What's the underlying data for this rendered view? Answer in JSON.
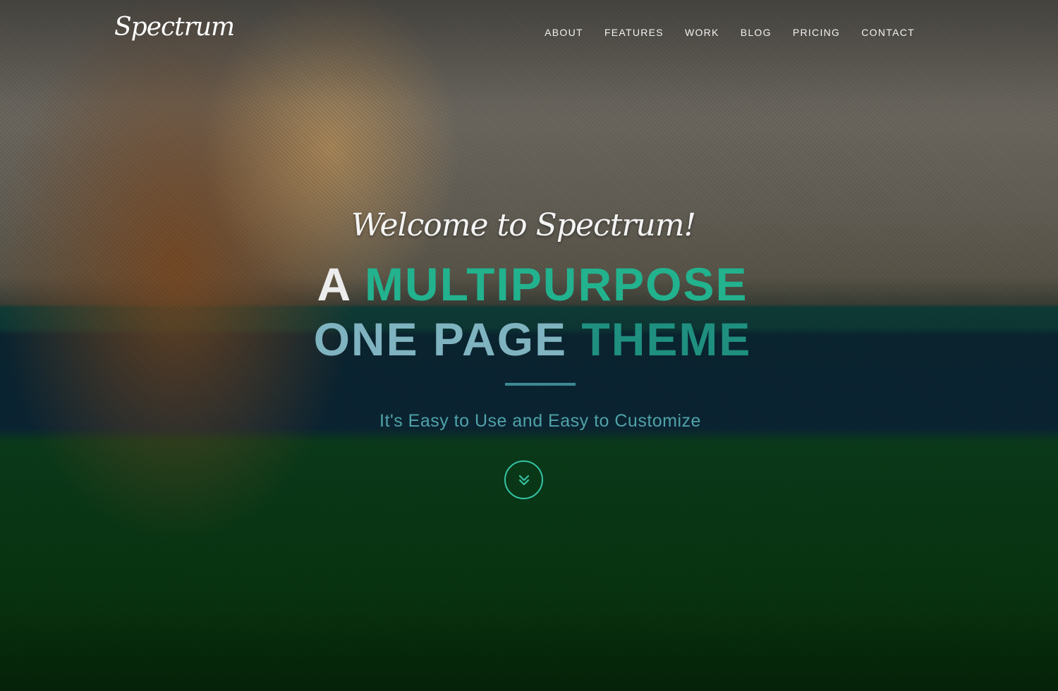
{
  "header": {
    "logo_text": "Spectrum",
    "nav": [
      {
        "label": "ABOUT"
      },
      {
        "label": "FEATURES"
      },
      {
        "label": "WORK"
      },
      {
        "label": "BLOG"
      },
      {
        "label": "PRICING"
      },
      {
        "label": "CONTACT"
      }
    ]
  },
  "hero": {
    "welcome": "Welcome to Spectrum!",
    "headline_line1_white": "A",
    "headline_line1_accent": "MULTIPURPOSE",
    "headline_line2_white": "ONE PAGE",
    "headline_line2_accent": "THEME",
    "tagline": "It's Easy to Use and Easy to Customize",
    "scroll_icon": "chevron-double-down-icon"
  },
  "colors": {
    "accent": "#22b28e",
    "divider": "#3d8a93",
    "tagline": "#4fa3a9"
  }
}
